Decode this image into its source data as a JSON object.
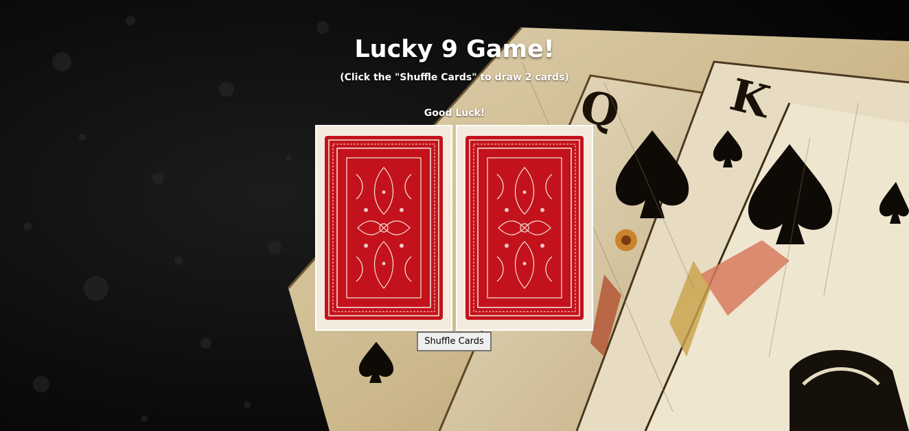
{
  "game": {
    "title": "Lucky 9 Game!",
    "subtitle": "(Click the \"Shuffle Cards\" to draw 2 cards)",
    "status": "Good Luck!",
    "shuffle_label": "Shuffle Cards"
  },
  "cards": [
    {
      "face": "back",
      "back_color": "#c4121c"
    },
    {
      "face": "back",
      "back_color": "#c4121c"
    }
  ],
  "background": {
    "description_icons": [
      "playing-cards-backdrop",
      "spade-icon",
      "queen-card",
      "king-card"
    ],
    "background_letters": [
      "Q",
      "K"
    ],
    "colors": {
      "dark": "#0b0b0b",
      "parchment": "#d8c7a0",
      "card_red": "#c4121c"
    }
  }
}
